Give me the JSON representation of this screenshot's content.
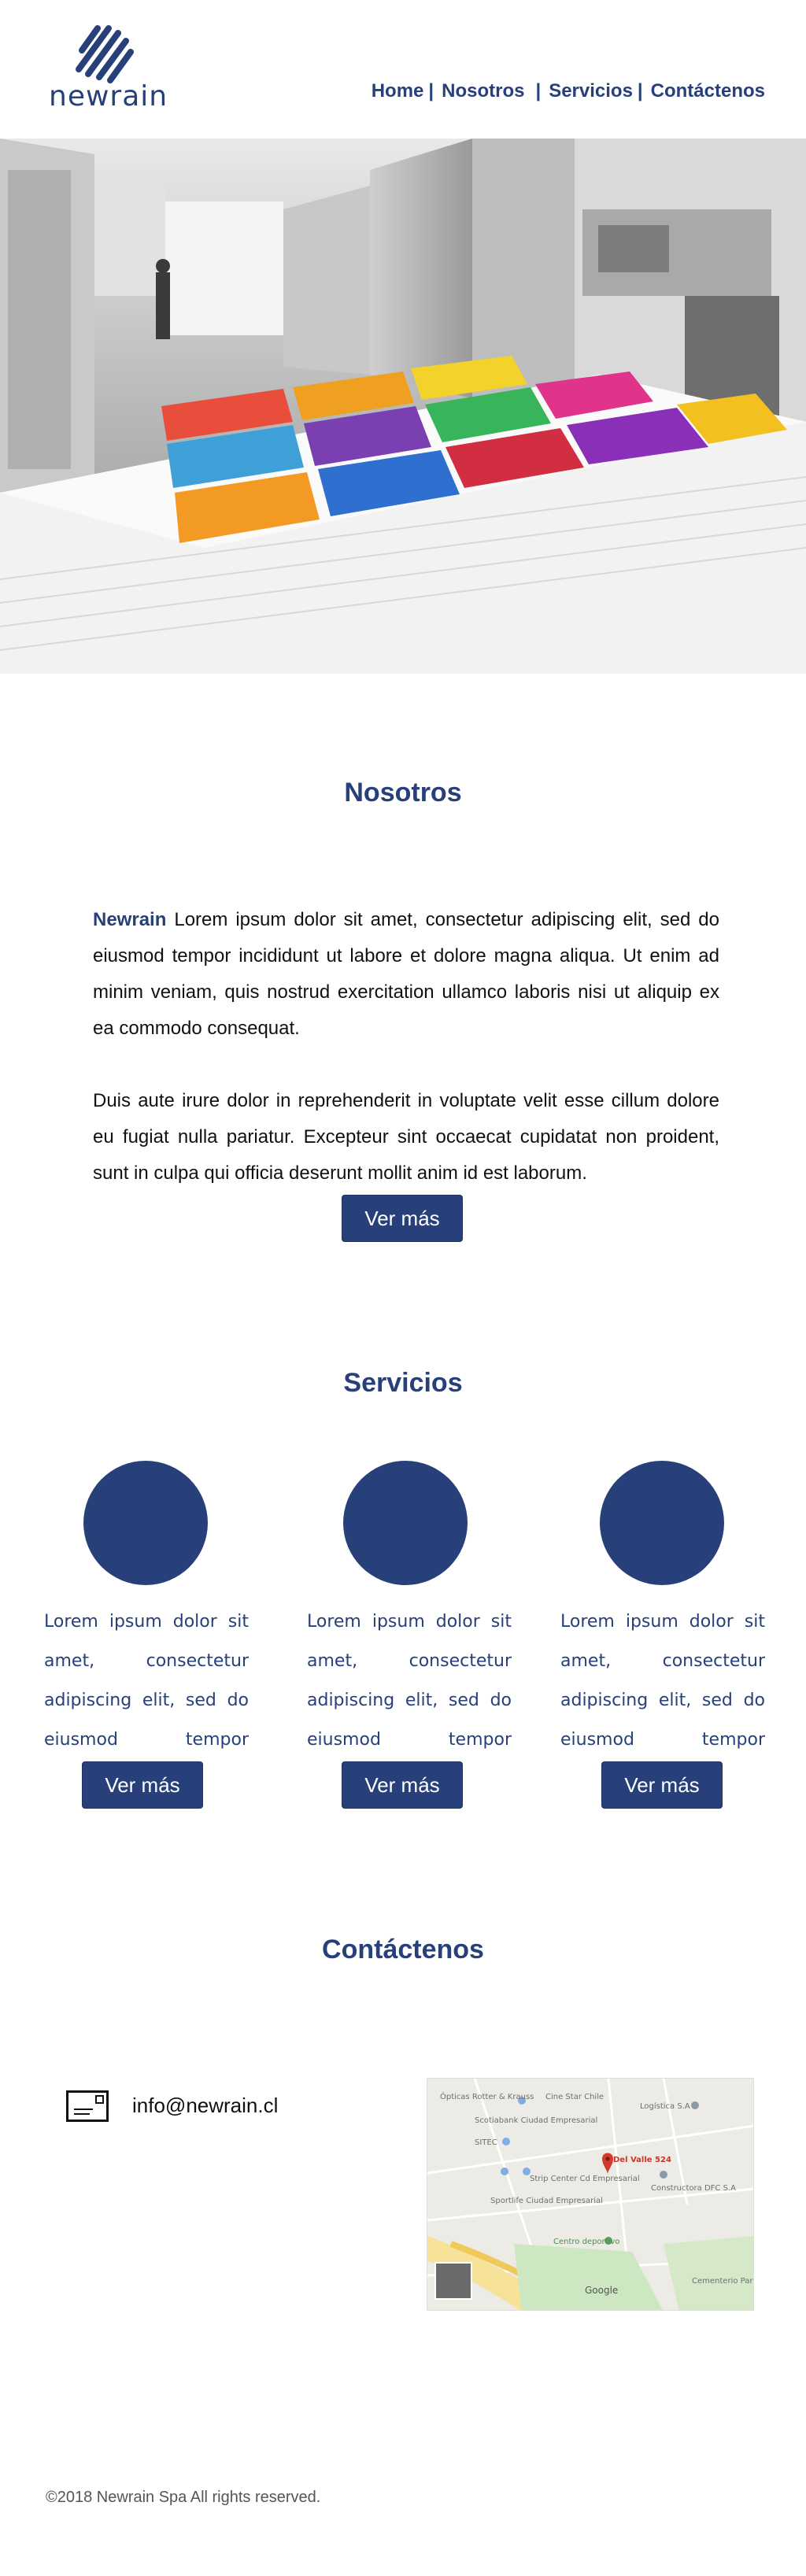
{
  "brand": {
    "name": "newrain",
    "color": "#28407a"
  },
  "nav": {
    "home": "Home",
    "nosotros": "Nosotros",
    "servicios": "Servicios",
    "contacto": "Contáctenos"
  },
  "nosotros": {
    "title": "Nosotros",
    "brand_word": "Newrain",
    "paragraph1": " Lorem ipsum dolor sit amet, consectetur adipiscing elit, sed do eiusmod tempor incididunt ut labore et dolore magna aliqua. Ut enim ad minim veniam, quis nostrud exercitation ullamco laboris nisi ut aliquip ex ea commodo consequat.",
    "paragraph2": "Duis aute irure dolor in reprehenderit in voluptate velit esse cillum dolore eu fugiat nulla pariatur. Excepteur sint occaecat cupidatat non proident, sunt in culpa qui officia deserunt mollit anim id est laborum.",
    "button": "Ver más"
  },
  "servicios": {
    "title": "Servicios",
    "items": [
      {
        "text": "Lorem ipsum dolor sit amet, consectetur adipiscing elit, sed do eiusmod tempor",
        "button": "Ver más"
      },
      {
        "text": "Lorem ipsum dolor sit amet, consectetur adipiscing elit, sed do eiusmod tempor",
        "button": "Ver más"
      },
      {
        "text": "Lorem ipsum dolor sit amet, consectetur adipiscing elit, sed do eiusmod tempor",
        "button": "Ver más"
      }
    ]
  },
  "contacto": {
    "title": "Contáctenos",
    "email": "info@newrain.cl",
    "map_labels": {
      "l1": "Ópticas Rotter & Krauss",
      "l2": "Cine Star Chile",
      "l3": "Logística S.A",
      "l4": "Scotiabank Ciudad Empresarial",
      "l5": "SITEC",
      "l6": "Del Valle 524",
      "l7": "Strip Center Cd Empresarial",
      "l8": "Constructora DFC S.A",
      "l9": "Sportlife Ciudad Empresarial",
      "l10": "Centro deportivo",
      "l11": "Google",
      "l12": "Cementerio Parque de Santiago"
    }
  },
  "footer": {
    "text": "©2018 Newrain Spa All rights reserved."
  }
}
